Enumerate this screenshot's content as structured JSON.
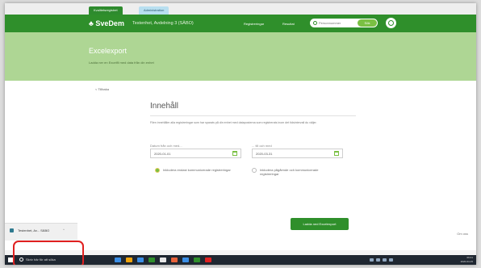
{
  "browser": {
    "tabs": [
      "Kvalitetsregistret",
      "Administration"
    ]
  },
  "header": {
    "logo_label": "SveDem",
    "context": "Testenhet, Avdelning 3 (SÄBO)",
    "nav": [
      "Registreringar",
      "Resultat"
    ],
    "search_placeholder": "Personnummer",
    "search_button": "Sök"
  },
  "hero": {
    "title": "Excelexport",
    "subtitle": "Ladda ner en Excelfil med data från din enhet"
  },
  "back_label": "< Tillbaka",
  "section": {
    "title": "Innehåll",
    "description": "Filen innehåller alla registreringar som har sparats på din enhet med dataposterna som registrerats inom det tidsintervall du väljer."
  },
  "date_from": {
    "label": "Datum från och med...",
    "value": "2020-01-01"
  },
  "date_to": {
    "label": "... till och med",
    "value": "2020-03-31"
  },
  "radio_options": [
    {
      "label": "Inkludera endast kommunicerade registreringar",
      "selected": true
    },
    {
      "label": "Inkludera pågående och kommunicerade registreringar",
      "selected": false
    }
  ],
  "export_button": "Ladda ned Excelexport",
  "footer_right": "Om oss",
  "notification": {
    "text": "Testenhet, Av...",
    "badge": "SÄBO"
  },
  "taskbar": {
    "search_placeholder": "Skriv här för att söka",
    "app_icon_colors": [
      "#3a8ee6",
      "#f0a30a",
      "#3a8ee6",
      "#2f8f2b",
      "#e6e6e6",
      "#e8623a",
      "#3a8ee6",
      "#2f8f2b",
      "#e02020"
    ],
    "clock_time": "09:41",
    "clock_date": "2020-04-15"
  },
  "colors": {
    "brand_green": "#2f8f2b",
    "hero_green": "#aed694",
    "accent_lime": "#7ac043",
    "highlight_red": "#e02020"
  }
}
